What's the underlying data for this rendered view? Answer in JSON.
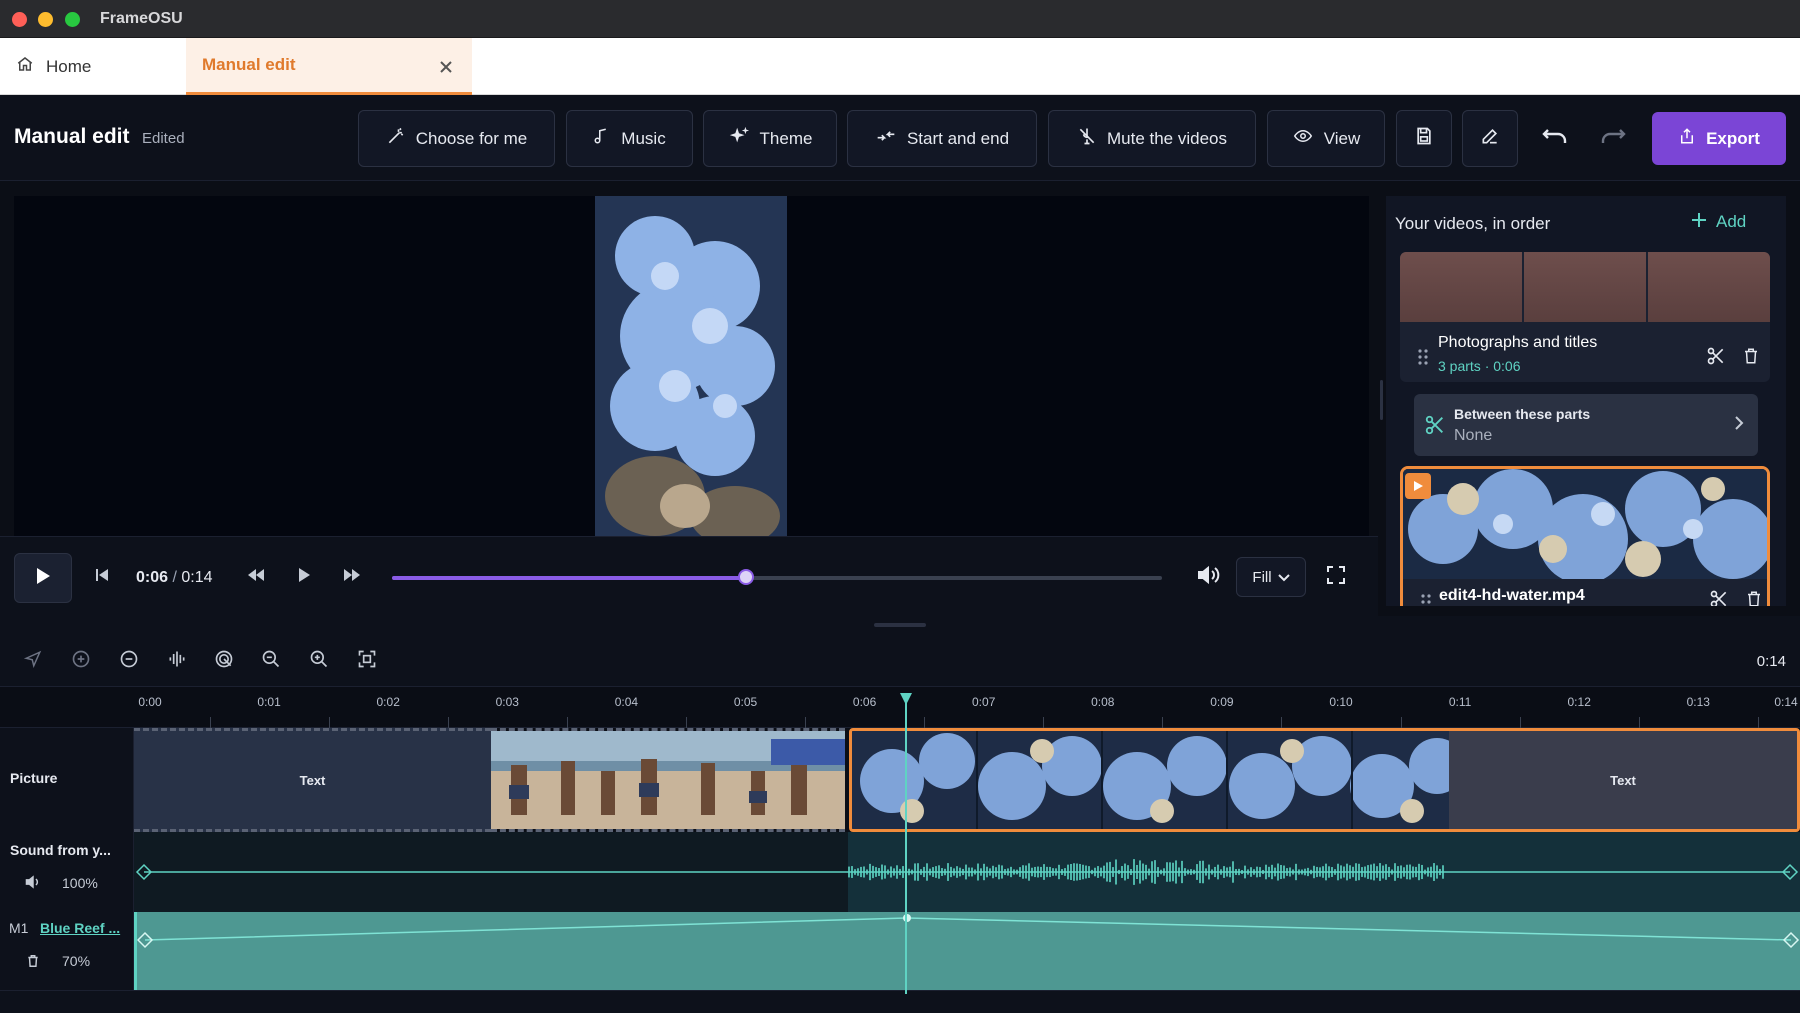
{
  "window": {
    "title": "FrameOSU"
  },
  "tabs": [
    {
      "label": "Home",
      "icon": "home-icon"
    },
    {
      "label": "Manual edit",
      "active": true
    }
  ],
  "toolbar": {
    "title": "Manual edit",
    "status": "Edited",
    "buttons": [
      {
        "label": "Choose for me",
        "icon": "magic-wand-icon"
      },
      {
        "label": "Music",
        "icon": "music-note-icon"
      },
      {
        "label": "Theme",
        "icon": "sparkles-icon"
      },
      {
        "label": "Start and end",
        "icon": "arrows-in-icon"
      },
      {
        "label": "Mute the videos",
        "icon": "mute-icon"
      },
      {
        "label": "View",
        "icon": "eye-icon"
      }
    ],
    "export_label": "Export",
    "accent_color": "#7b45d6"
  },
  "player": {
    "current_time": "0:06",
    "separator": "/",
    "total_time": "0:14",
    "progress_fraction": 0.46,
    "fill_option": "Fill"
  },
  "side_panel": {
    "title": "Your videos, in order",
    "add_label": "Add",
    "group": {
      "name": "Photographs and titles",
      "meta": "3 parts · 0:06"
    },
    "transition": {
      "label": "Between these parts",
      "value": "None"
    },
    "clip": {
      "name": "edit4-hd-water.mp4"
    }
  },
  "timeline": {
    "duration": "0:14",
    "ticks": [
      "0:00",
      "0:01",
      "0:02",
      "0:03",
      "0:04",
      "0:05",
      "0:06",
      "0:07",
      "0:08",
      "0:09",
      "0:10",
      "0:11",
      "0:12",
      "0:13",
      "0:14"
    ],
    "playhead_time": 6.35,
    "tracks": {
      "picture": {
        "name": "Picture",
        "segments": [
          {
            "label": "Text"
          },
          {
            "label": ""
          },
          {
            "label": ""
          },
          {
            "label": "Text"
          }
        ]
      },
      "sound": {
        "name": "Sound from y...",
        "volume": "100%"
      },
      "music": {
        "id": "M1",
        "name": "Blue Reef ...",
        "volume": "70%"
      }
    }
  },
  "colors": {
    "accent_orange": "#f08c3c",
    "teal": "#5fd3c3",
    "purple": "#7b45d6"
  }
}
